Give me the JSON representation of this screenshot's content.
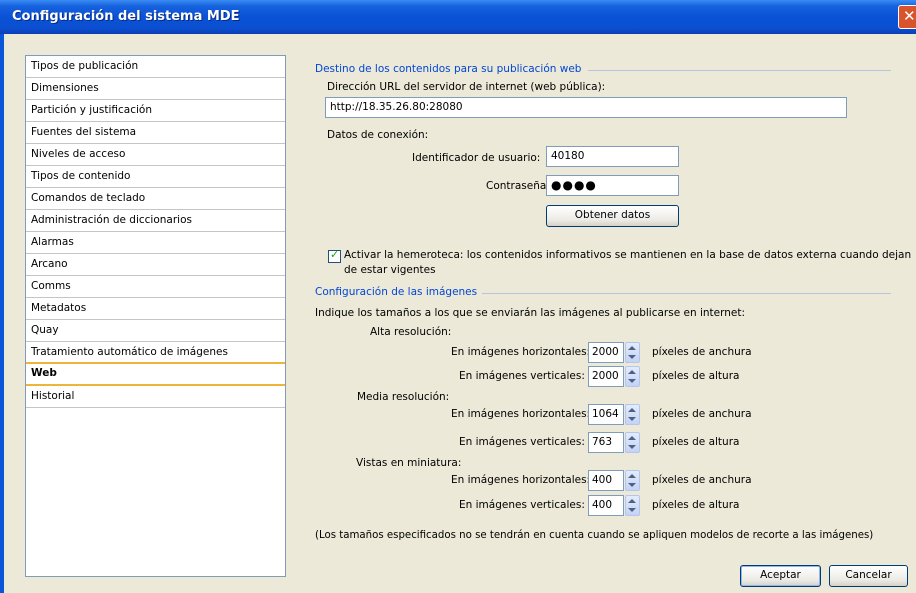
{
  "window": {
    "title": "Configuración del sistema MDE",
    "close_glyph": "✕"
  },
  "sidebar": {
    "items": [
      {
        "label": "Tipos de publicación"
      },
      {
        "label": "Dimensiones"
      },
      {
        "label": "Partición y justificación"
      },
      {
        "label": "Fuentes del sistema"
      },
      {
        "label": "Niveles de acceso"
      },
      {
        "label": "Tipos de contenido"
      },
      {
        "label": "Comandos de teclado"
      },
      {
        "label": "Administración de diccionarios"
      },
      {
        "label": "Alarmas"
      },
      {
        "label": "Arcano"
      },
      {
        "label": "Comms"
      },
      {
        "label": "Metadatos"
      },
      {
        "label": "Quay"
      },
      {
        "label": "Tratamiento automático de imágenes"
      },
      {
        "label": "Web",
        "selected": true
      },
      {
        "label": "Historial"
      }
    ]
  },
  "web": {
    "section_title": "Destino de los contenidos para su publicación web",
    "url_label": "Dirección URL del servidor de internet (web pública):",
    "url_value": "http://18.35.26.80:28080",
    "conn_label": "Datos de conexión:",
    "user_label": "Identificador de usuario:",
    "user_value": "40180",
    "pass_label": "Contraseña:",
    "pass_value": "●●●●",
    "fetch_button": "Obtener datos",
    "archive_checked": true,
    "check_glyph": "✓",
    "archive_label_1": "Activar la hemeroteca: los contenidos informativos se mantienen en la base de datos externa cuando dejan",
    "archive_label_2": "de estar vigentes"
  },
  "images": {
    "section_title": "Configuración de las imágenes",
    "intro": "Indique los tamaños a los que se enviarán las imágenes al publicarse en internet:",
    "high": {
      "label": "Alta resolución:",
      "h_label": "En imágenes horizontales:",
      "h_value": "2000",
      "h_unit": "píxeles de anchura",
      "v_label": "En imágenes verticales:",
      "v_value": "2000",
      "v_unit": "píxeles de altura"
    },
    "medium": {
      "label": "Media resolución:",
      "h_label": "En imágenes horizontales:",
      "h_value": "1064",
      "h_unit": "píxeles de anchura",
      "v_label": "En imágenes verticales:",
      "v_value": "763",
      "v_unit": "píxeles de altura"
    },
    "thumb": {
      "label": "Vistas en miniatura:",
      "h_label": "En imágenes horizontales:",
      "h_value": "400",
      "h_unit": "píxeles de anchura",
      "v_label": "En imágenes verticales:",
      "v_value": "400",
      "v_unit": "píxeles de altura"
    },
    "note": "(Los tamaños especificados no se tendrán en cuenta cuando se apliquen modelos de recorte a las imágenes)"
  },
  "footer": {
    "accept": "Aceptar",
    "cancel": "Cancelar"
  }
}
